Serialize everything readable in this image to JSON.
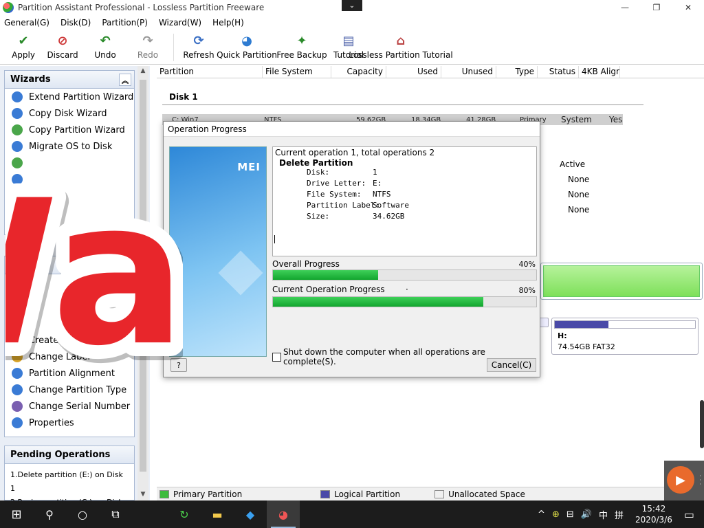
{
  "window": {
    "title": "Partition Assistant Professional - Lossless Partition Freeware",
    "chevron": "⌄",
    "buttons": {
      "minimize": "—",
      "restore": "❐",
      "close": "✕"
    }
  },
  "menu": [
    "General(G)",
    "Disk(D)",
    "Partition(P)",
    "Wizard(W)",
    "Help(H)"
  ],
  "toolbar": [
    {
      "label": "Apply",
      "icon": "check-icon",
      "glyph": "✔",
      "color": "#2a8a2a"
    },
    {
      "label": "Discard",
      "icon": "discard-icon",
      "glyph": "⊘",
      "color": "#c33"
    },
    {
      "label": "Undo",
      "icon": "undo-icon",
      "glyph": "↶",
      "color": "#2a8a2a"
    },
    {
      "label": "Redo",
      "icon": "redo-icon",
      "glyph": "↷",
      "color": "#999",
      "disabled": true
    },
    {
      "label": "Refresh",
      "icon": "refresh-icon",
      "glyph": "⟳",
      "color": "#3a6fc4"
    },
    {
      "label": "Quick Partition",
      "icon": "quick-partition-icon",
      "glyph": "◕",
      "color": "#2e7bd1"
    },
    {
      "label": "Free Backup",
      "icon": "backup-icon",
      "glyph": "✦",
      "color": "#2a8a2a"
    },
    {
      "label": "Tutorial",
      "icon": "tutorial-icon",
      "glyph": "▤",
      "color": "#4a5fa8"
    },
    {
      "label": "Lossless Partition Tutorial",
      "icon": "lossless-tutorial-icon",
      "glyph": "⌂",
      "color": "#b44"
    }
  ],
  "wizard_panel": {
    "title": "Wizards",
    "collapse": "︽",
    "items": [
      {
        "label": "Extend Partition Wizard",
        "color": "#3a7bd5"
      },
      {
        "label": "Copy Disk Wizard",
        "color": "#3a7bd5"
      },
      {
        "label": "Copy Partition Wizard",
        "color": "#4aa64a"
      },
      {
        "label": "Migrate OS to Disk",
        "color": "#3a7bd5"
      },
      {
        "label": "",
        "color": "#4aa64a"
      },
      {
        "label": "",
        "color": "#3a7bd5"
      }
    ]
  },
  "ops_panel": {
    "items": [
      {
        "label": "Create Partition",
        "color": "#4aa64a"
      },
      {
        "label": "Change Label",
        "color": "#d9a52a"
      },
      {
        "label": "Partition Alignment",
        "color": "#3a7bd5"
      },
      {
        "label": "Change Partition Type",
        "color": "#3a7bd5"
      },
      {
        "label": "Change Serial Number",
        "color": "#7a5fb0"
      },
      {
        "label": "Properties",
        "color": "#3a7bd5"
      }
    ]
  },
  "pending_panel": {
    "title": "Pending Operations",
    "items": [
      "1.Delete partition (E:) on Disk 1",
      "2.Resize partition (C:) on Disk..."
    ]
  },
  "table": {
    "headers": [
      "Partition",
      "File System",
      "Capacity",
      "Used",
      "Unused",
      "Type",
      "Status",
      "4KB Aligned"
    ],
    "disk_label": "Disk 1",
    "row": {
      "name": "C: Win7",
      "fs": "NTFS",
      "capacity": "59.62GB",
      "used": "18.34GB",
      "unused": "41.28GB",
      "type": "Primary",
      "status": "System",
      "aligned": "Yes"
    },
    "status_values": [
      "Active",
      "None",
      "None",
      "None"
    ]
  },
  "disk_map": {
    "h_label": "H:",
    "h_detail": "74.54GB FAT32",
    "h_fill_fraction": 0.38
  },
  "legend": [
    {
      "label": "Primary Partition",
      "color": "#3dbb3d"
    },
    {
      "label": "Logical Partition",
      "color": "#4a4aa8"
    },
    {
      "label": "Unallocated Space",
      "color": "#f0f0f0"
    }
  ],
  "dialog": {
    "title": "Operation Progress",
    "banner_logo": "MEI",
    "current_op": "Current operation 1, total operations 2",
    "op_name": "Delete Partition",
    "fields": [
      {
        "k": "Disk:",
        "v": "1"
      },
      {
        "k": "Drive Letter:",
        "v": "E:"
      },
      {
        "k": "File System:",
        "v": "NTFS"
      },
      {
        "k": "Partition Label:",
        "v": "Software"
      },
      {
        "k": "Size:",
        "v": "34.62GB"
      }
    ],
    "total_label": "Overall Progress",
    "total_pct": "40%",
    "total_fraction": 0.4,
    "current_label": "Current Operation Progress",
    "current_dot": "·",
    "current_pct": "80%",
    "current_fraction": 0.8,
    "shutdown_label": "Shut down the computer when all operations are complete(S).",
    "cancel_label": "Cancel(C)",
    "help_glyph": "?"
  },
  "sticker": {
    "text": "Wait",
    "fill": "#e8262b"
  },
  "taskbar": {
    "start": "⊞",
    "search": "⚲",
    "cortana": "○",
    "taskview": "⧉",
    "apps": [
      "↻",
      "▬",
      "◆",
      "◕"
    ],
    "tray": [
      "^",
      "⊕",
      "⊟",
      "🔊",
      "中",
      "拼"
    ],
    "time": "15:42",
    "date": "2020/3/6",
    "notify": "▭"
  }
}
